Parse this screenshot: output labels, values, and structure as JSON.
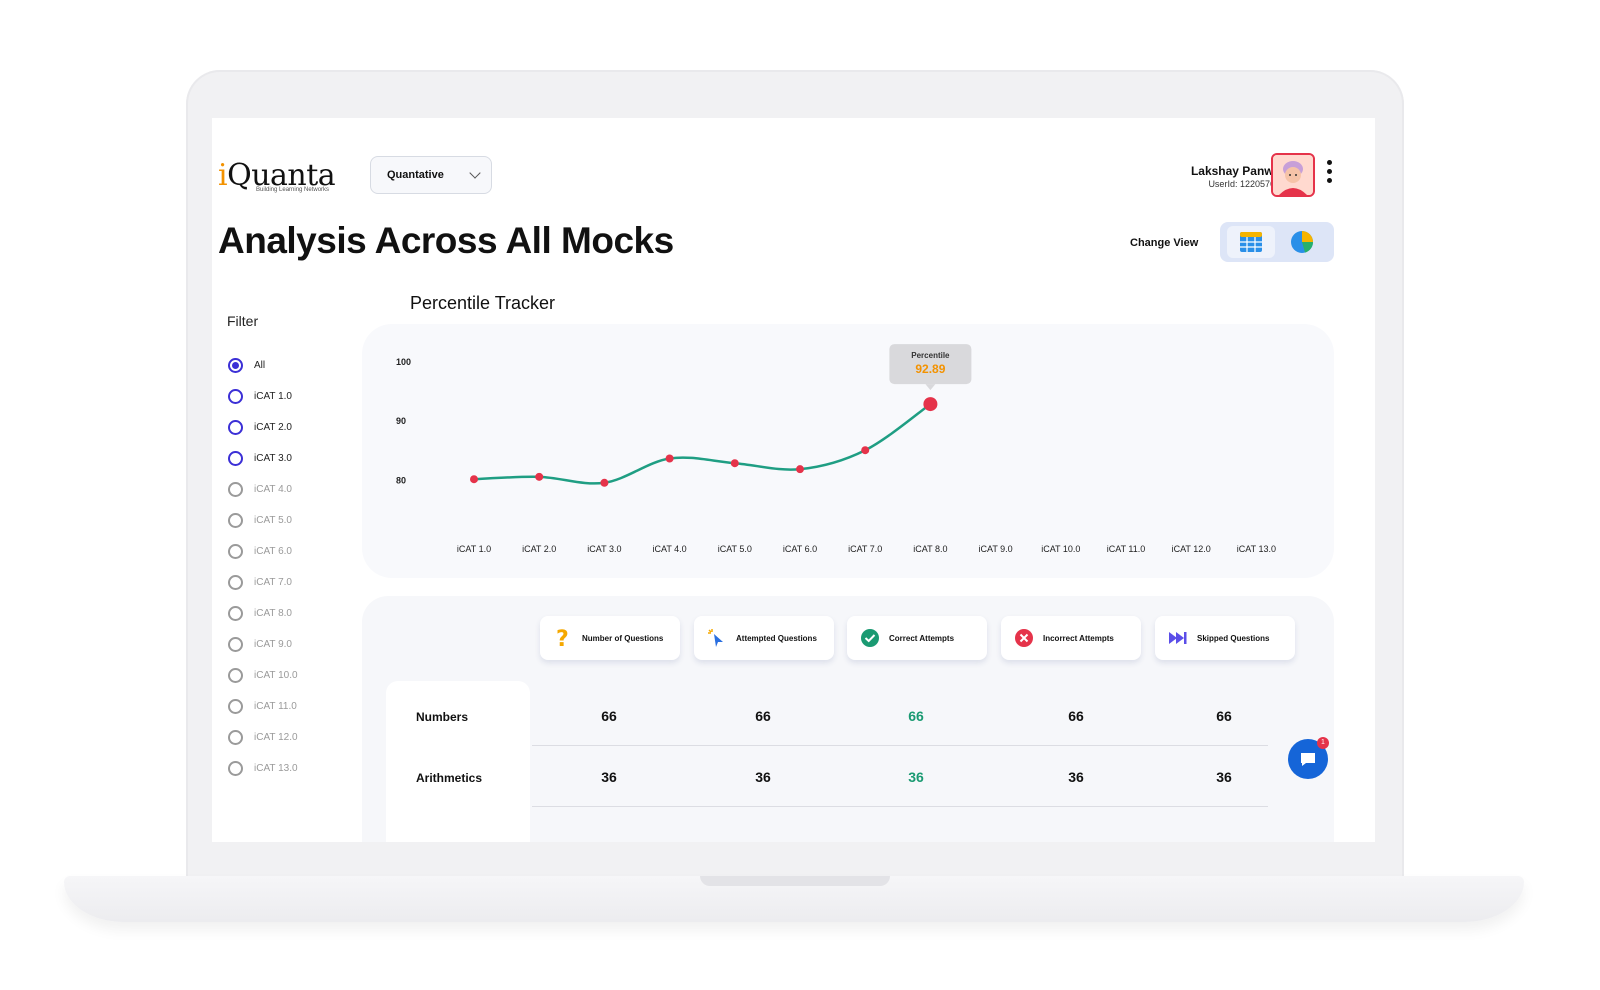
{
  "header": {
    "logo_letter": "i",
    "logo_rest": "Quanta",
    "logo_tagline": "Building Learning Networks",
    "subject": "Quantative",
    "user_name": "Lakshay Panwar",
    "user_id": "UserId: 122057643"
  },
  "page": {
    "title": "Analysis Across All Mocks",
    "change_view_label": "Change View"
  },
  "filter": {
    "title": "Filter",
    "items": [
      {
        "label": "All",
        "checked": true,
        "enabled": true
      },
      {
        "label": "iCAT 1.0",
        "checked": false,
        "enabled": true
      },
      {
        "label": "iCAT 2.0",
        "checked": false,
        "enabled": true
      },
      {
        "label": "iCAT 3.0",
        "checked": false,
        "enabled": true
      },
      {
        "label": "iCAT 4.0",
        "checked": false,
        "enabled": false
      },
      {
        "label": "iCAT 5.0",
        "checked": false,
        "enabled": false
      },
      {
        "label": "iCAT 6.0",
        "checked": false,
        "enabled": false
      },
      {
        "label": "iCAT 7.0",
        "checked": false,
        "enabled": false
      },
      {
        "label": "iCAT 8.0",
        "checked": false,
        "enabled": false
      },
      {
        "label": "iCAT 9.0",
        "checked": false,
        "enabled": false
      },
      {
        "label": "iCAT 10.0",
        "checked": false,
        "enabled": false
      },
      {
        "label": "iCAT 11.0",
        "checked": false,
        "enabled": false
      },
      {
        "label": "iCAT 12.0",
        "checked": false,
        "enabled": false
      },
      {
        "label": "iCAT 13.0",
        "checked": false,
        "enabled": false
      }
    ]
  },
  "chart_data": {
    "type": "line",
    "title": "Percentile Tracker",
    "categories": [
      "iCAT 1.0",
      "iCAT 2.0",
      "iCAT 3.0",
      "iCAT 4.0",
      "iCAT 5.0",
      "iCAT 6.0",
      "iCAT 7.0",
      "iCAT 8.0",
      "iCAT 9.0",
      "iCAT 10.0",
      "iCAT 11.0",
      "iCAT 12.0",
      "iCAT 13.0"
    ],
    "values": [
      80.2,
      80.6,
      79.6,
      83.7,
      82.9,
      81.9,
      85.1,
      92.89,
      null,
      null,
      null,
      null,
      null
    ],
    "y_ticks": [
      80,
      90,
      100
    ],
    "ylim": [
      75,
      100
    ],
    "tooltip": {
      "label": "Percentile",
      "value": "92.89"
    },
    "line_color": "#1f9e83",
    "point_color": "#e5334a",
    "grid": false
  },
  "stats": {
    "headers": [
      {
        "label": "Number of Questions",
        "icon": "question-icon"
      },
      {
        "label": "Attempted Questions",
        "icon": "cursor-click-icon"
      },
      {
        "label": "Correct Attempts",
        "icon": "check-circle-icon"
      },
      {
        "label": "Incorrect Attempts",
        "icon": "x-circle-icon"
      },
      {
        "label": "Skipped Questions",
        "icon": "skip-forward-icon"
      }
    ],
    "rows": [
      {
        "label": "Numbers",
        "values": [
          "66",
          "66",
          "66",
          "66",
          "66"
        ]
      },
      {
        "label": "Arithmetics",
        "values": [
          "36",
          "36",
          "36",
          "36",
          "36"
        ]
      }
    ]
  },
  "chat": {
    "badge": "1"
  },
  "colors": {
    "accent": "#3b2fd6",
    "brand_orange": "#f39200",
    "correct_green": "#1a9a72",
    "incorrect_red": "#e5334a"
  }
}
